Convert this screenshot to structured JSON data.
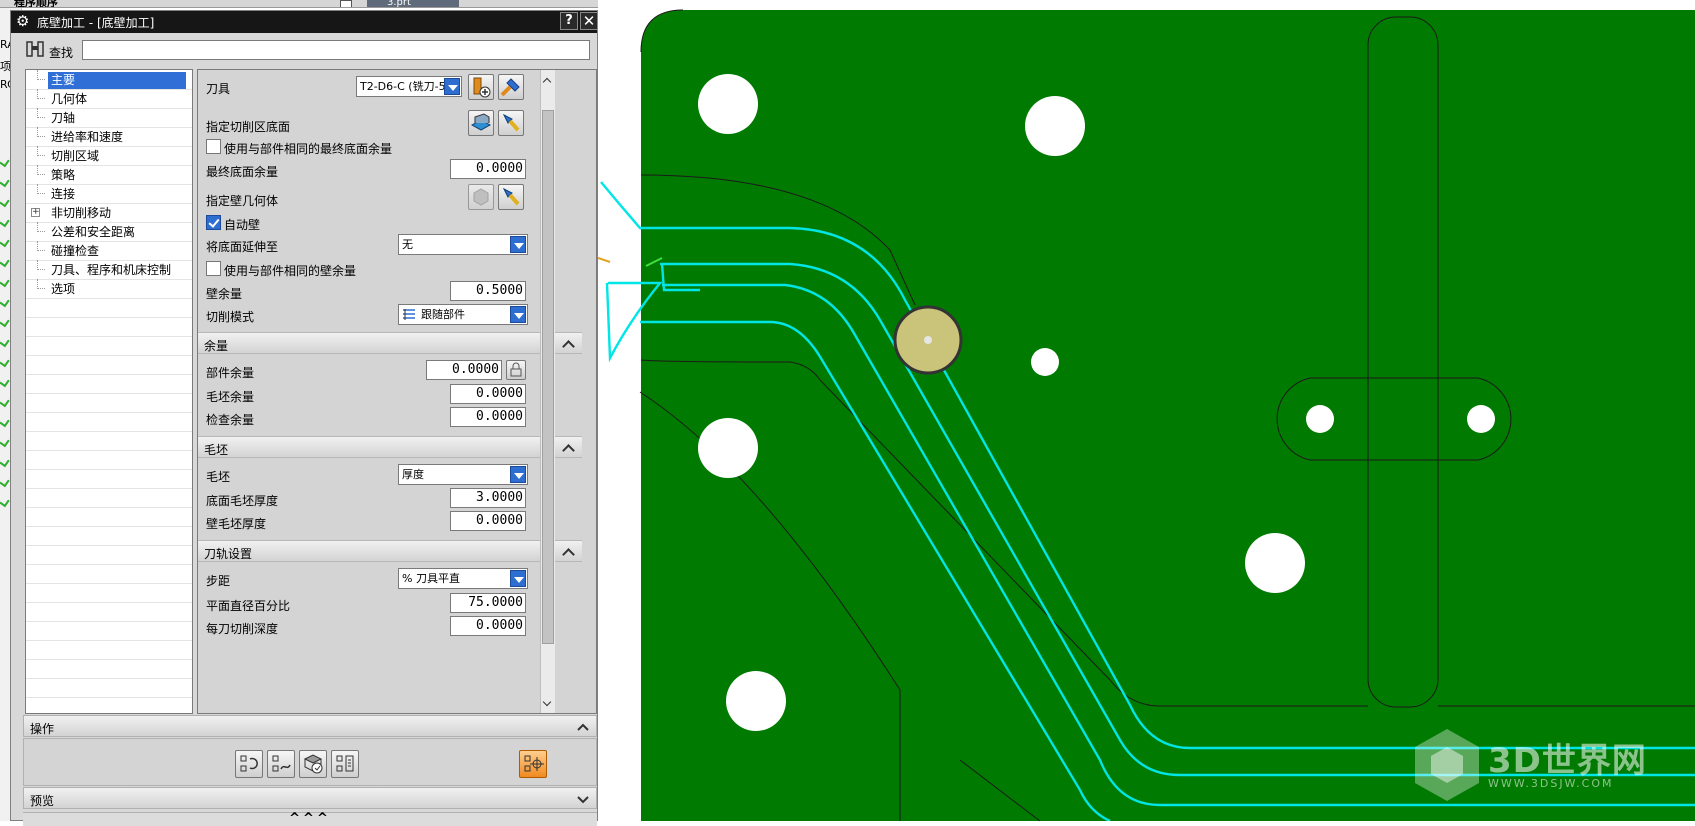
{
  "top_strip": {
    "title_text": "程序顺序",
    "tab_label": "3.prt"
  },
  "left_strip": {
    "labels": [
      "RA",
      "项",
      "RC"
    ]
  },
  "dialog": {
    "title": "底壁加工 - [底壁加工]",
    "help_label": "?",
    "close_label": "✕",
    "find_label": "查找",
    "find_value": "",
    "tree_items": [
      {
        "label": "主要",
        "selected": true,
        "expandable": false
      },
      {
        "label": "几何体",
        "selected": false,
        "expandable": false
      },
      {
        "label": "刀轴",
        "selected": false,
        "expandable": false
      },
      {
        "label": "进给率和速度",
        "selected": false,
        "expandable": false
      },
      {
        "label": "切削区域",
        "selected": false,
        "expandable": false
      },
      {
        "label": "策略",
        "selected": false,
        "expandable": false
      },
      {
        "label": "连接",
        "selected": false,
        "expandable": false
      },
      {
        "label": "非切削移动",
        "selected": false,
        "expandable": true
      },
      {
        "label": "公差和安全距离",
        "selected": false,
        "expandable": false
      },
      {
        "label": "碰撞检查",
        "selected": false,
        "expandable": false
      },
      {
        "label": "刀具、程序和机床控制",
        "selected": false,
        "expandable": false
      },
      {
        "label": "选项",
        "selected": false,
        "expandable": false
      }
    ],
    "main": {
      "tool_label": "刀具",
      "tool_value": "T2-D6-C (铣刀-5",
      "cut_area_floor_label": "指定切削区底面",
      "same_final_floor_label": "使用与部件相同的最终底面余量",
      "same_final_floor_checked": false,
      "final_floor_stock_label": "最终底面余量",
      "final_floor_stock_value": "0.0000",
      "wall_geometry_label": "指定壁几何体",
      "auto_wall_label": "自动壁",
      "auto_wall_checked": true,
      "extend_floor_label": "将底面延伸至",
      "extend_floor_value": "无",
      "same_wall_stock_label": "使用与部件相同的壁余量",
      "same_wall_stock_checked": false,
      "wall_stock_label": "壁余量",
      "wall_stock_value": "0.5000",
      "cut_pattern_label": "切削模式",
      "cut_pattern_value": "跟随部件"
    },
    "stock_section": {
      "title": "余量",
      "part_stock_label": "部件余量",
      "part_stock_value": "0.0000",
      "blank_stock_label": "毛坯余量",
      "blank_stock_value": "0.0000",
      "check_stock_label": "检查余量",
      "check_stock_value": "0.0000"
    },
    "blank_section": {
      "title": "毛坯",
      "blank_label": "毛坯",
      "blank_value": "厚度",
      "floor_blank_label": "底面毛坯厚度",
      "floor_blank_value": "3.0000",
      "wall_blank_label": "壁毛坯厚度",
      "wall_blank_value": "0.0000"
    },
    "path_section": {
      "title": "刀轨设置",
      "stepover_label": "步距",
      "stepover_value": "% 刀具平直",
      "flat_pct_label": "平面直径百分比",
      "flat_pct_value": "75.0000",
      "depth_label": "每刀切削深度",
      "depth_value": "0.0000"
    },
    "actions_title": "操作",
    "preview_title": "预览",
    "more_label": "^^^"
  },
  "viewport": {
    "part_color": "#007a00",
    "toolpath_color": "#00e5e5",
    "tool_color": "#c9c47a"
  },
  "watermark": {
    "brand": "3D世界网",
    "url": "WWW.3DSJW.COM"
  }
}
